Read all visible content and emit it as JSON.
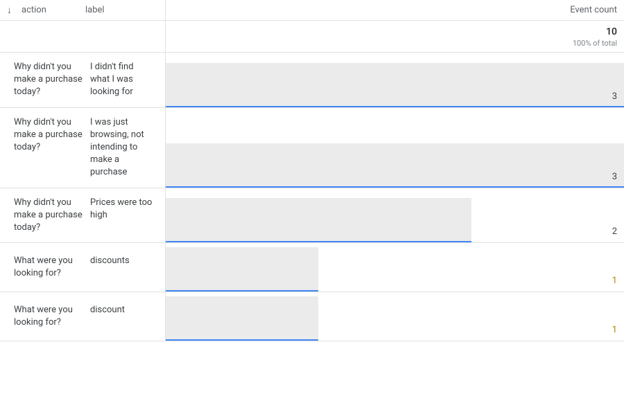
{
  "header": {
    "sort_arrow": "↓",
    "dim1": "action",
    "dim2": "label",
    "metric": "Event count"
  },
  "total": {
    "value": "10",
    "sub": "100% of total"
  },
  "rows": [
    {
      "action": "Why didn't you make a purchase today?",
      "label": "I didn't find what I was looking for",
      "value": 3,
      "value_text": "3",
      "color": "dark"
    },
    {
      "action": "Why didn't you make a purchase today?",
      "label": "I was just browsing, not intending to make a purchase",
      "value": 3,
      "value_text": "3",
      "color": "dark"
    },
    {
      "action": "Why didn't you make a purchase today?",
      "label": "Prices were too high",
      "value": 2,
      "value_text": "2",
      "color": "dark"
    },
    {
      "action": "What were you looking for?",
      "label": "discounts",
      "value": 1,
      "value_text": "1",
      "color": "gold"
    },
    {
      "action": "What were you looking for?",
      "label": "discount",
      "value": 1,
      "value_text": "1",
      "color": "gold"
    }
  ],
  "chart_data": {
    "type": "bar",
    "title": "Event count",
    "xlabel": "Event count",
    "ylabel": "action / label",
    "xlim": [
      0,
      3
    ],
    "categories": [
      "Why didn't you make a purchase today? — I didn't find what I was looking for",
      "Why didn't you make a purchase today? — I was just browsing, not intending to make a purchase",
      "Why didn't you make a purchase today? — Prices were too high",
      "What were you looking for? — discounts",
      "What were you looking for? — discount"
    ],
    "values": [
      3,
      3,
      2,
      1,
      1
    ],
    "total": 10
  }
}
